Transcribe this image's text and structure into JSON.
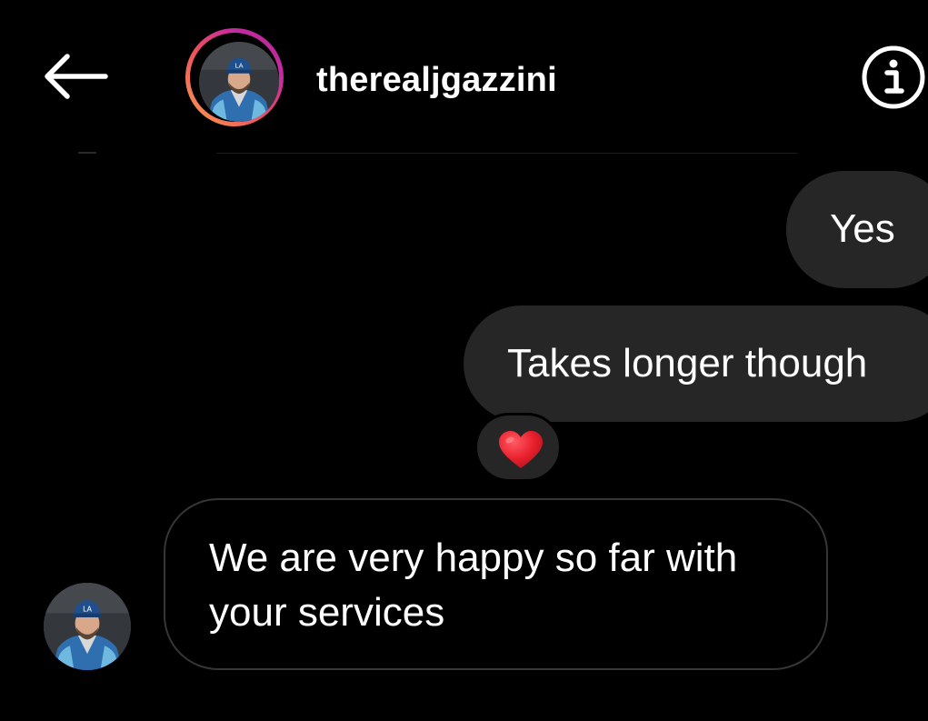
{
  "header": {
    "username": "therealjgazzini",
    "icons": {
      "back": "arrow-left-icon",
      "info": "info-circle-icon"
    }
  },
  "messages": [
    {
      "direction": "outgoing",
      "text": "Yes"
    },
    {
      "direction": "outgoing",
      "text": "Takes longer though",
      "reaction": "heart-emoji"
    },
    {
      "direction": "incoming",
      "text": "We are very happy so far with your services"
    }
  ],
  "colors": {
    "background": "#000000",
    "outgoing_bubble": "#262626",
    "incoming_border": "#363636",
    "text": "#ffffff",
    "heart": "#e8202d"
  }
}
